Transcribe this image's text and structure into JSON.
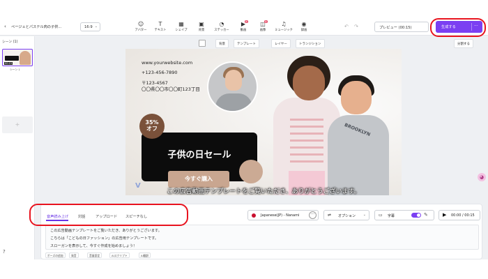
{
  "header": {
    "back_icon": "chevron-left-icon",
    "title": "ページェとパステル肉の子供...",
    "ratio": "16:9",
    "tools": [
      {
        "label": "アバター",
        "icon": "avatar-icon",
        "glyph": "☺"
      },
      {
        "label": "テキスト",
        "icon": "text-icon",
        "glyph": "T"
      },
      {
        "label": "シェイプ",
        "icon": "shape-icon",
        "glyph": "▦"
      },
      {
        "label": "背景",
        "icon": "background-icon",
        "glyph": "▣"
      },
      {
        "label": "ステッカー",
        "icon": "sticker-icon",
        "glyph": "◔"
      },
      {
        "label": "動画",
        "icon": "video-icon",
        "glyph": "▶"
      },
      {
        "label": "画像",
        "icon": "image-icon",
        "glyph": "◫"
      },
      {
        "label": "ミュージック",
        "icon": "music-icon",
        "glyph": "♫"
      },
      {
        "label": "録画",
        "icon": "record-icon",
        "glyph": "◉"
      }
    ],
    "badge_video": "新",
    "badge_image": "新",
    "undo_icon": "↶",
    "redo_icon": "↷",
    "preview_label": "プレビュー (00:15)",
    "generate_label": "生成する",
    "more_label": "···"
  },
  "left_panel": {
    "scenes_label": "シーン (1)",
    "thumb_duration": "00:15",
    "scene_name": "シーン 1",
    "add_icon": "+",
    "help_icon": "?"
  },
  "canvas_toolbar": {
    "items": [
      "背景",
      "テンプレート",
      "レイヤー",
      "トランジション"
    ],
    "split_label": "分割する"
  },
  "canvas": {
    "website": "www.yourwebsite.com",
    "phone": "+123-456-7890",
    "zip": "〒123-4567",
    "address": "〇〇県〇〇市〇〇町123丁目",
    "discount_line1": "35%",
    "discount_line2": "オフ",
    "sale_title": "子供の日セール",
    "cta": "今すぐ購入",
    "kid_shirt_text": "BROOKLYN",
    "logo": "V",
    "subtitle": "この広告動画テンプレートをご覧いただき、ありがとうございます。"
  },
  "script_panel": {
    "tabs": [
      "音声読み上げ",
      "対話",
      "アップロード",
      "スピーチなし"
    ],
    "voice": "Japanese(JP) - Nanami",
    "voice_more": "···",
    "options_label": "オプション",
    "subtitle_label": "字幕",
    "subtitle_toggle": "on",
    "time": "00:00 / 00:15",
    "lines": [
      "この広告動画テンプレートをご覧いただき、ありがとうございます。",
      "こちらは「こどもの日ファッション」の広告用テンプレートです。",
      "スローガンを表示して、今すぐ作成を始めましょう！"
    ],
    "chips": [
      "ポーズの追加",
      "発音",
      "音量設定",
      "AIスクリプト",
      "AI翻訳"
    ]
  },
  "annotation_color": "#e8131e",
  "accent_color": "#7b3ff2"
}
